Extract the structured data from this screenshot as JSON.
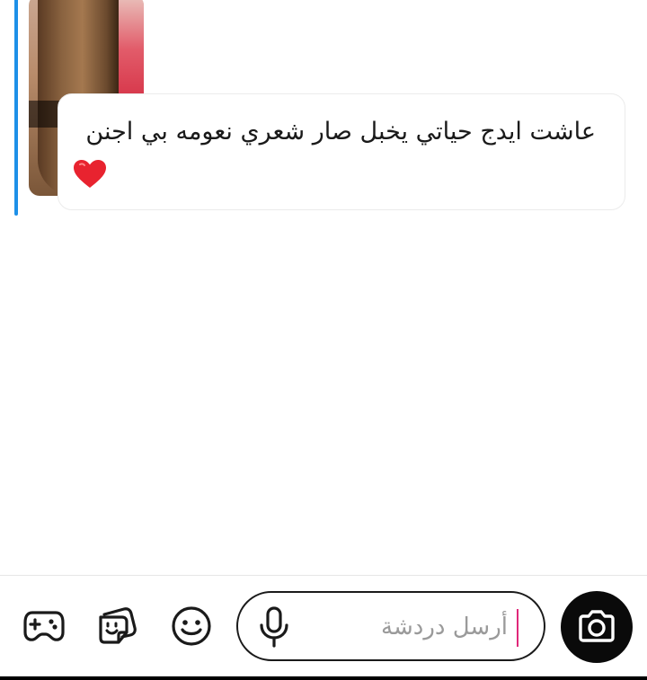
{
  "theme": {
    "accent": "#1e90e8",
    "caret": "#e0287a",
    "text": "#1a1a1a",
    "placeholder": "#9a9a9a"
  },
  "message": {
    "text": "عاشت ايدج حياتي يخبل صار شعري نعومه بي اجنن",
    "emoji": "heart-icon"
  },
  "snap": {
    "thumbnail": "hair-photo-thumbnail"
  },
  "composer": {
    "placeholder": "أرسل دردشة",
    "icons": [
      "game-controller-icon",
      "sticker-icon",
      "emoji-icon",
      "microphone-icon",
      "camera-icon"
    ]
  }
}
